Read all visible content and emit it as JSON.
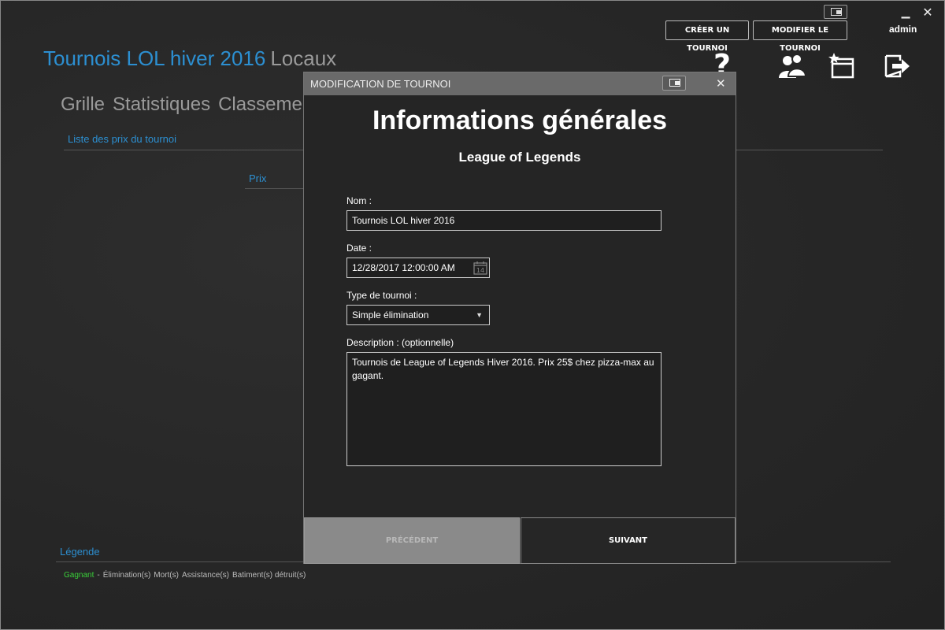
{
  "header": {
    "create_button": "CRÉER UN TOURNOI",
    "modify_button": "MODIFIER LE TOURNOI",
    "user": "admin",
    "title": "Tournois LOL hiver 2016",
    "subtitle": "Locaux",
    "icons": [
      "help-icon",
      "users-icon",
      "add-tournament-icon",
      "logout-icon"
    ]
  },
  "nav": {
    "items": [
      "Grille",
      "Statistiques",
      "Classement"
    ]
  },
  "main": {
    "prize_list_label": "Liste des prix du tournoi",
    "prize_column": "Prix"
  },
  "legend": {
    "title": "Légende",
    "winner": "Gagnant",
    "separator": "-",
    "items": [
      "Élimination(s)",
      "Mort(s)",
      "Assistance(s)",
      "Batiment(s) détruit(s)"
    ]
  },
  "modal": {
    "title": "MODIFICATION DE TOURNOI",
    "heading": "Informations générales",
    "game": "League of Legends",
    "name_label": "Nom :",
    "name_value": "Tournois LOL hiver 2016",
    "date_label": "Date :",
    "date_value": "12/28/2017 12:00:00 AM",
    "calendar_day": "14",
    "type_label": "Type de tournoi :",
    "type_value": "Simple élimination",
    "description_label": "Description : (optionnelle)",
    "description_value": "Tournois de League of Legends Hiver 2016. Prix 25$ chez pizza-max au gagant.",
    "prev_button": "PRÉCÉDENT",
    "next_button": "SUIVANT"
  },
  "colors": {
    "accent": "#2c8fd1",
    "winner": "#3ad13a",
    "background": "#262626"
  }
}
